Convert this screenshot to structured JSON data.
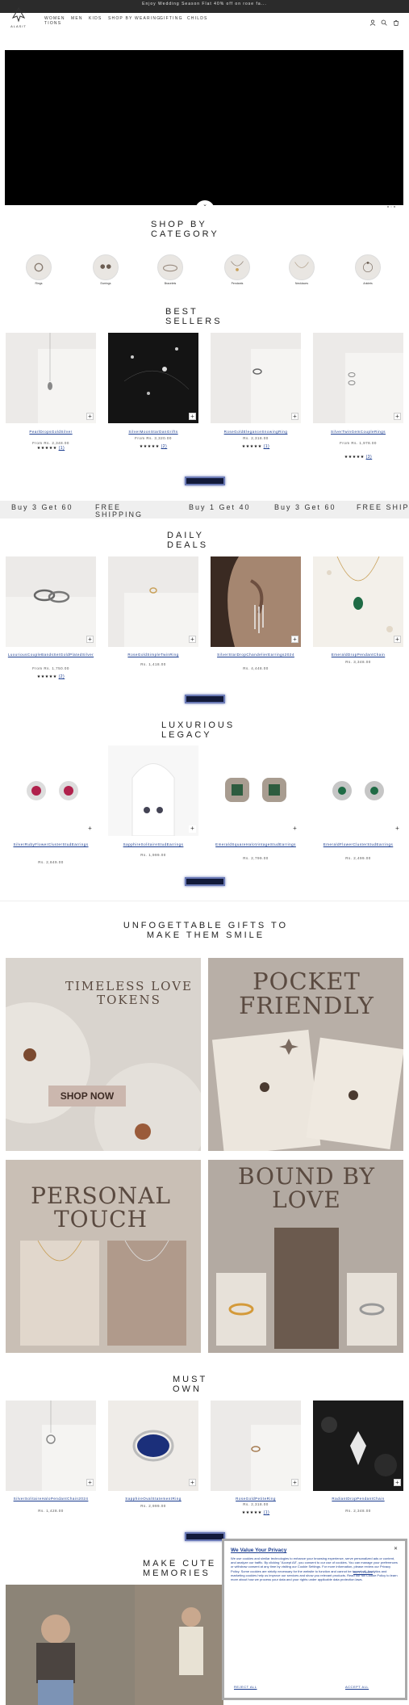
{
  "announcement": "Enjoy Wedding Season Flat 40% off on rose fa...",
  "brand": {
    "name": "ALASIT"
  },
  "nav": [
    "WOMEN TIONS",
    "MEN",
    "KIDS",
    "SHOP BY WEARING",
    "GIFTING",
    "CHILDS"
  ],
  "header_icons": [
    "user-icon",
    "search-icon",
    "cart-icon"
  ],
  "sections": {
    "categories_title": "SHOP BY CATEGORY",
    "bestsellers_title": "BEST SELLERS",
    "daily_title": "DAILY DEALS",
    "legacy_title": "LUXURIOUS LEGACY",
    "gifts_title": "UNFOGETTABLE GIFTS TO MAKE THEM SMILE",
    "mustown_title": "MUST OWN",
    "memories_title": "MAKE CUTE MEMORIES"
  },
  "categories": [
    "Rings",
    "Earrings",
    "Bracelets",
    "Pendants",
    "Necklaces",
    "Anklets"
  ],
  "bestsellers": [
    {
      "name": "PearlDropsGoldSilver",
      "price": "From Rs. 2,348.00",
      "stars": "★★★★★",
      "reviews": "(1)"
    },
    {
      "name": "SilverMoonStarDanGrifts",
      "price": "From Rs. 3,320.00",
      "stars": "★★★★★",
      "reviews": "(2)"
    },
    {
      "name": "RoseGoldEleganceSnowingRing",
      "price": "Rs. 2,318.00",
      "stars": "★★★★★",
      "reviews": "(1)"
    },
    {
      "name": "SilverTwinGemCoupleRings",
      "price": "From Rs. 1,978.00",
      "stars": "★★★★★",
      "reviews": "(3)"
    }
  ],
  "marquee": [
    "Buy 3 Get 60",
    "FREE SHIPPING",
    "Buy 1 Get 40",
    "Buy 3 Get 60",
    "FREE SHIP"
  ],
  "daily": [
    {
      "name": "LuxuriousCoupleBandsSetGoldPlatedSilver",
      "price": "From Rs. 1,750.00",
      "stars": "★★★★★",
      "reviews": "(2)"
    },
    {
      "name": "RoseGoldSimpleTwinRing",
      "price": "Rs. 1,418.00",
      "stars": "",
      "reviews": ""
    },
    {
      "name": "SilverStarDropChandelierEarrings2024",
      "price": "Rs. 4,448.00",
      "stars": "",
      "reviews": ""
    },
    {
      "name": "EmeraldDropPendantChain",
      "price": "Rs. 3,348.00",
      "stars": "",
      "reviews": ""
    }
  ],
  "legacy": [
    {
      "name": "SilverRubyFlowerClusterStudEarrings",
      "price": "Rs. 2,849.00"
    },
    {
      "name": "SapphireSolitaireStudEarrings",
      "price": "Rs. 1,999.00"
    },
    {
      "name": "EmeraldSquareHaloVintageStudEarrings",
      "price": "Rs. 2,799.00"
    },
    {
      "name": "EmeraldFlowerClusterStudEarrings",
      "price": "Rs. 2,499.00"
    }
  ],
  "gift_banners": [
    {
      "title": "TIMELESS LOVE TOKENS",
      "cta": "SHOP NOW"
    },
    {
      "title": "POCKET FRIENDLY"
    },
    {
      "title": "PERSONAL TOUCH"
    },
    {
      "title": "BOUND BY LOVE"
    }
  ],
  "mustown": [
    {
      "name": "SilverSolitaireHaloPendantChain2024",
      "price": "Rs. 1,428.00",
      "stars": "",
      "reviews": ""
    },
    {
      "name": "SapphireOvalStatementRing",
      "price": "Rs. 2,999.00",
      "stars": "",
      "reviews": ""
    },
    {
      "name": "RoseGoldPetiteRing",
      "price": "Rs. 2,318.00",
      "stars": "★★★★★",
      "reviews": "(1)"
    },
    {
      "name": "RadiantDropPendantChain",
      "price": "Rs. 2,348.00",
      "stars": "",
      "reviews": ""
    }
  ],
  "consent": {
    "title": "We Value Your Privacy",
    "body": "We use cookies and similar technologies to enhance your browsing experience, serve personalized ads or content, and analyze our traffic. By clicking \"Accept All\", you consent to our use of cookies. You can manage your preferences or withdraw consent at any time by visiting our Cookie Settings. For more information, please review our Privacy Policy. Some cookies are strictly necessary for the website to function and cannot be turned off. Analytics and marketing cookies help us improve our services and show you relevant products. Read our full Cookie Policy to learn more about how we process your data and your rights under applicable data protection laws.",
    "settings": "SETTINGS",
    "reject": "REJECT ALL",
    "accept": "ACCEPT ALL"
  }
}
